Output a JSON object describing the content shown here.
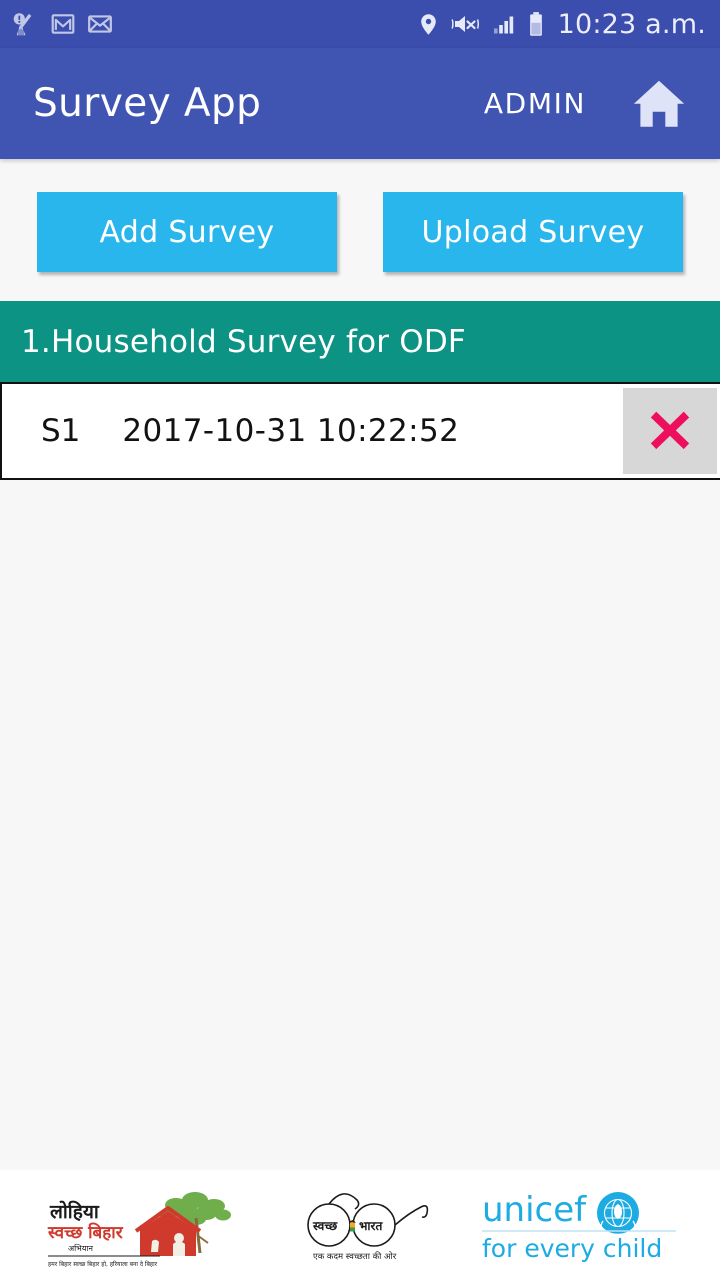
{
  "status_bar": {
    "icons_left": [
      "cleaner-alert-icon",
      "gmail-icon",
      "envelope-icon"
    ],
    "icons_right": [
      "location-pin-icon",
      "sound-mute-icon",
      "signal-bars-icon",
      "battery-icon"
    ],
    "time": "10:23 a.m."
  },
  "app_bar": {
    "title": "Survey App",
    "user_role": "ADMIN",
    "home_icon": "home-icon"
  },
  "toolbar": {
    "add_survey_label": "Add Survey",
    "upload_survey_label": "Upload Survey"
  },
  "section": {
    "header_title": "1.Household Survey for ODF"
  },
  "surveys": [
    {
      "id": "S1",
      "datetime": "2017-10-31 10:22:52",
      "delete_icon": "cross-icon"
    }
  ],
  "footer": {
    "logos": [
      {
        "name": "lohia-swachh-bihar-logo",
        "line1": "लोहिया",
        "line2": "स्वच्छ बिहार",
        "line3": "अभियान",
        "line4": "हमर बिहार स्वच्छ बिहार हो, हरियाला बना दे बिहार"
      },
      {
        "name": "swachh-bharat-logo",
        "left_lens": "स्वच्छ",
        "right_lens": "भारत",
        "tagline": "एक कदम स्वच्छता की ओर"
      },
      {
        "name": "unicef-logo",
        "wordmark": "unicef",
        "tagline": "for every child"
      }
    ]
  },
  "colors": {
    "status_bar": "#3b4eae",
    "app_bar": "#4054b2",
    "button_blue": "#29b6ec",
    "section_teal": "#0c9384",
    "delete_cross": "#ed0f5e",
    "page_background": "#f7f7f7",
    "unicef_blue": "#1cabe2"
  }
}
